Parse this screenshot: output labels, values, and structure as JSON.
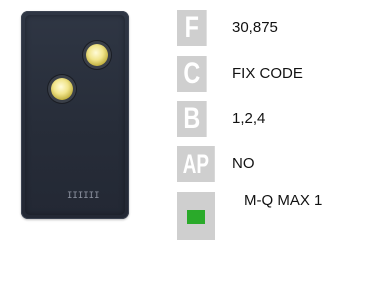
{
  "device": {
    "mark": "IIIIII"
  },
  "specs": [
    {
      "badge": "F",
      "value": "30,875"
    },
    {
      "badge": "C",
      "value": "FIX CODE"
    },
    {
      "badge": "B",
      "value": "1,2,4"
    },
    {
      "badge": "AP",
      "value": "NO"
    }
  ],
  "compat": {
    "swatch_color": "#2aaa2a",
    "value": "M-Q MAX 1"
  }
}
